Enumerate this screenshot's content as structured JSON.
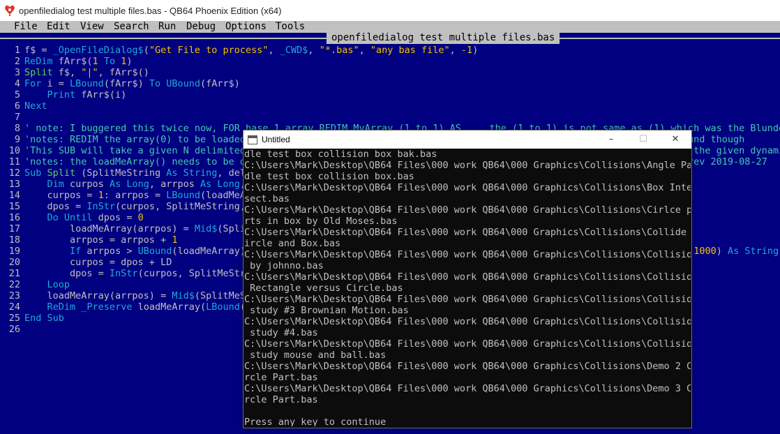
{
  "window": {
    "title": "openfiledialog test multiple files.bas - QB64 Phoenix Edition (x64)",
    "icon": "qb64-heart-icon"
  },
  "menu": [
    "File",
    "Edit",
    "View",
    "Search",
    "Run",
    "Debug",
    "Options",
    "Tools"
  ],
  "file_tab": "openfiledialog test multiple files.bas",
  "line_numbers": [
    "1",
    "2",
    "3",
    "4",
    "5",
    "6",
    "7",
    "8",
    "9",
    "10",
    "11",
    "12",
    "13",
    "14",
    "15",
    "16",
    "17",
    "18",
    "19",
    "20",
    "21",
    "22",
    "23",
    "24",
    "25",
    "26"
  ],
  "code_lines": [
    [
      [
        "plain",
        "f$ = "
      ],
      [
        "fn",
        "_OpenFileDialog$"
      ],
      [
        "plain",
        "("
      ],
      [
        "str",
        "\"Get File to process\""
      ],
      [
        "plain",
        ", "
      ],
      [
        "fn",
        "_CWD$"
      ],
      [
        "plain",
        ", "
      ],
      [
        "str",
        "\"*.bas\""
      ],
      [
        "plain",
        ", "
      ],
      [
        "str",
        "\"any bas file\""
      ],
      [
        "plain",
        ", "
      ],
      [
        "num",
        "-1"
      ],
      [
        "plain",
        ")"
      ]
    ],
    [
      [
        "kw",
        "ReDim"
      ],
      [
        "plain",
        " fArr$("
      ],
      [
        "num",
        "1"
      ],
      [
        "plain",
        " "
      ],
      [
        "kw",
        "To"
      ],
      [
        "plain",
        " "
      ],
      [
        "num",
        "1"
      ],
      [
        "plain",
        ")"
      ]
    ],
    [
      [
        "kw2",
        "Split"
      ],
      [
        "plain",
        " f$, "
      ],
      [
        "str",
        "\"|\""
      ],
      [
        "plain",
        ", fArr$()"
      ]
    ],
    [
      [
        "kw",
        "For"
      ],
      [
        "plain",
        " i = "
      ],
      [
        "fn",
        "LBound"
      ],
      [
        "plain",
        "(fArr$) "
      ],
      [
        "kw",
        "To"
      ],
      [
        "plain",
        " "
      ],
      [
        "fn",
        "UBound"
      ],
      [
        "plain",
        "(fArr$)"
      ]
    ],
    [
      [
        "plain",
        "    "
      ],
      [
        "kw",
        "Print"
      ],
      [
        "plain",
        " fArr$(i)"
      ]
    ],
    [
      [
        "kw",
        "Next"
      ]
    ],
    [
      [
        "plain",
        ""
      ]
    ],
    [
      [
        "cmt",
        "' note: I buggered this twice now, FOR base 1 array REDIM MyArray (1 to 1) AS ... the (1 to 1) is not same as (1) which was the Blunder"
      ]
    ],
    [
      [
        "cmt",
        "'notes: REDIM the array(0) to be loaded before calling Split '<<<< IMPORTANT dynamic array and empty, can use any lbound though"
      ]
    ],
    [
      [
        "cmt",
        "'This SUB will take a given N delimited string, and delimiter$ and create an array of N+1 strings using the LBound of the given dynamic"
      ]
    ],
    [
      [
        "cmt",
        "'notes: the loadMeArray() needs to be dynamic string array and will not change the LBound of the array it is given.  rev 2019-08-27"
      ]
    ],
    [
      [
        "kw",
        "Sub"
      ],
      [
        "plain",
        " "
      ],
      [
        "kw2",
        "Split"
      ],
      [
        "plain",
        " (SplitMeString "
      ],
      [
        "kw",
        "As String"
      ],
      [
        "plain",
        ", delim "
      ],
      [
        "kw",
        "As String"
      ],
      [
        "plain",
        ", loadMeArray() "
      ],
      [
        "kw",
        "As String"
      ],
      [
        "plain",
        ")"
      ]
    ],
    [
      [
        "plain",
        "    "
      ],
      [
        "kw",
        "Dim"
      ],
      [
        "plain",
        " curpos "
      ],
      [
        "kw",
        "As Long"
      ],
      [
        "plain",
        ", arrpos "
      ],
      [
        "kw",
        "As Long"
      ],
      [
        "plain",
        ", LD "
      ],
      [
        "kw",
        "As Long"
      ],
      [
        "plain",
        ", dpos "
      ],
      [
        "kw",
        "As Long"
      ]
    ],
    [
      [
        "plain",
        "    curpos = "
      ],
      [
        "num",
        "1"
      ],
      [
        "plain",
        ": arrpos = "
      ],
      [
        "fn",
        "LBound"
      ],
      [
        "plain",
        "(loadMeArray): LD = "
      ],
      [
        "fn",
        "Len"
      ],
      [
        "plain",
        "(delim)"
      ]
    ],
    [
      [
        "plain",
        "    dpos = "
      ],
      [
        "fn",
        "InStr"
      ],
      [
        "plain",
        "(curpos, SplitMeString, delim)"
      ]
    ],
    [
      [
        "plain",
        "    "
      ],
      [
        "kw",
        "Do Until"
      ],
      [
        "plain",
        " dpos = "
      ],
      [
        "num",
        "0"
      ]
    ],
    [
      [
        "plain",
        "        loadMeArray(arrpos) = "
      ],
      [
        "fn",
        "Mid$"
      ],
      [
        "plain",
        "(SplitMeString, curpos, dpos - curpos)"
      ]
    ],
    [
      [
        "plain",
        "        arrpos = arrpos + "
      ],
      [
        "num",
        "1"
      ]
    ],
    [
      [
        "plain",
        "        "
      ],
      [
        "kw",
        "If"
      ],
      [
        "plain",
        " arrpos > "
      ],
      [
        "fn",
        "UBound"
      ],
      [
        "plain",
        "(loadMeArray) "
      ],
      [
        "kw",
        "Then"
      ],
      [
        "plain",
        " "
      ],
      [
        "kw",
        "ReDim"
      ],
      [
        "plain",
        " "
      ],
      [
        "kw",
        "_Preserve"
      ],
      [
        "plain",
        " loadMeArray("
      ],
      [
        "fn",
        "LBound"
      ],
      [
        "plain",
        "(loadMeArray) "
      ],
      [
        "kw",
        "To"
      ],
      [
        "plain",
        " "
      ],
      [
        "fn",
        "UBound"
      ],
      [
        "plain",
        "(loadMeArray) + "
      ],
      [
        "num",
        "1000"
      ],
      [
        "plain",
        ") "
      ],
      [
        "kw",
        "As String"
      ]
    ],
    [
      [
        "plain",
        "        curpos = dpos + LD"
      ]
    ],
    [
      [
        "plain",
        "        dpos = "
      ],
      [
        "fn",
        "InStr"
      ],
      [
        "plain",
        "(curpos, SplitMeString, delim)"
      ]
    ],
    [
      [
        "plain",
        "    "
      ],
      [
        "kw",
        "Loop"
      ]
    ],
    [
      [
        "plain",
        "    loadMeArray(arrpos) = "
      ],
      [
        "fn",
        "Mid$"
      ],
      [
        "plain",
        "(SplitMeString, curpos)"
      ]
    ],
    [
      [
        "plain",
        "    "
      ],
      [
        "kw",
        "ReDim"
      ],
      [
        "plain",
        " "
      ],
      [
        "kw",
        "_Preserve"
      ],
      [
        "plain",
        " loadMeArray("
      ],
      [
        "fn",
        "LBound"
      ],
      [
        "plain",
        "(loadMeArray) "
      ],
      [
        "kw",
        "To"
      ],
      [
        "plain",
        " arrpos) "
      ],
      [
        "kw",
        "As String"
      ]
    ],
    [
      [
        "kw",
        "End Sub"
      ]
    ],
    [
      [
        "plain",
        ""
      ]
    ]
  ],
  "console": {
    "title": "Untitled",
    "controls": [
      "–",
      "☐",
      "✕"
    ],
    "lines": [
      "dle test box collision box bak.bas",
      "C:\\Users\\Mark\\Desktop\\QB64 Files\\000 work QB64\\000 Graphics\\Collisions\\Angle Pad",
      "dle test box collision box.bas",
      "C:\\Users\\Mark\\Desktop\\QB64 Files\\000 work QB64\\000 Graphics\\Collisions\\Box Inter",
      "sect.bas",
      "C:\\Users\\Mark\\Desktop\\QB64 Files\\000 work QB64\\000 Graphics\\Collisions\\Cirlce pa",
      "rts in box by Old Moses.bas",
      "C:\\Users\\Mark\\Desktop\\QB64 Files\\000 work QB64\\000 Graphics\\Collisions\\Collide C",
      "ircle and Box.bas",
      "C:\\Users\\Mark\\Desktop\\QB64 Files\\000 work QB64\\000 Graphics\\Collisions\\Collision",
      " by johnno.bas",
      "C:\\Users\\Mark\\Desktop\\QB64 Files\\000 work QB64\\000 Graphics\\Collisions\\Collision",
      " Rectangle versus Circle.bas",
      "C:\\Users\\Mark\\Desktop\\QB64 Files\\000 work QB64\\000 Graphics\\Collisions\\Collision",
      " study #3 Brownian Motion.bas",
      "C:\\Users\\Mark\\Desktop\\QB64 Files\\000 work QB64\\000 Graphics\\Collisions\\Collision",
      " study #4.bas",
      "C:\\Users\\Mark\\Desktop\\QB64 Files\\000 work QB64\\000 Graphics\\Collisions\\Collision",
      " study mouse and ball.bas",
      "C:\\Users\\Mark\\Desktop\\QB64 Files\\000 work QB64\\000 Graphics\\Collisions\\Demo 2 Ci",
      "rcle Part.bas",
      "C:\\Users\\Mark\\Desktop\\QB64 Files\\000 work QB64\\000 Graphics\\Collisions\\Demo 3 Ci",
      "rcle Part.bas",
      "",
      "Press any key to continue"
    ]
  }
}
